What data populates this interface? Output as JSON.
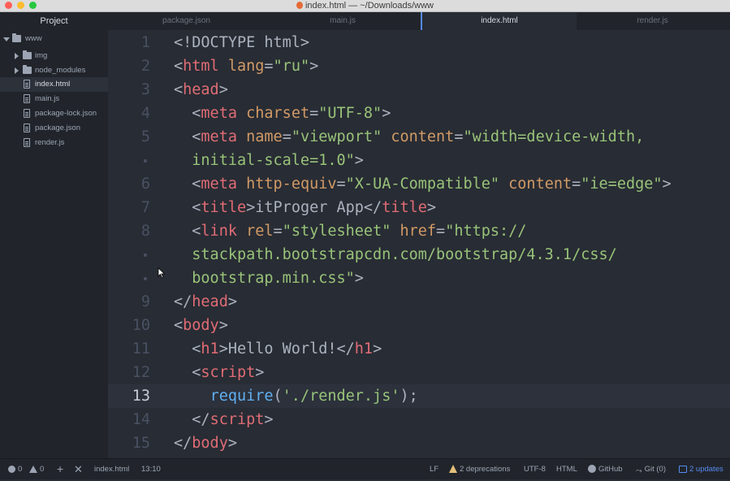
{
  "window": {
    "title": "index.html — ~/Downloads/www"
  },
  "tabs": {
    "project_label": "Project",
    "items": [
      {
        "label": "package.json"
      },
      {
        "label": "main.js"
      },
      {
        "label": "index.html"
      },
      {
        "label": "render.js"
      }
    ]
  },
  "tree": {
    "root": "www",
    "items": [
      {
        "label": "img",
        "type": "folder"
      },
      {
        "label": "node_modules",
        "type": "folder"
      },
      {
        "label": "index.html",
        "type": "file"
      },
      {
        "label": "main.js",
        "type": "file"
      },
      {
        "label": "package-lock.json",
        "type": "file"
      },
      {
        "label": "package.json",
        "type": "file"
      },
      {
        "label": "render.js",
        "type": "file"
      }
    ]
  },
  "editor": {
    "gutter": [
      "1",
      "2",
      "3",
      "4",
      "5",
      "",
      "6",
      "7",
      "8",
      "",
      "",
      "9",
      "10",
      "11",
      "12",
      "13",
      "14",
      "15"
    ],
    "current_line": "13"
  },
  "status": {
    "errors": "0",
    "warnings": "0",
    "file": "index.html",
    "position": "13:10",
    "line_ending": "LF",
    "deprecations": "2 deprecations",
    "encoding": "UTF-8",
    "grammar": "HTML",
    "github": "GitHub",
    "git": "Git (0)",
    "updates": "2 updates"
  },
  "colors": {
    "accent": "#568af2",
    "tag": "#e06c75",
    "attribute": "#d19a66",
    "string": "#98c379",
    "function": "#61afef",
    "warning": "#e5c07b"
  },
  "icons": [
    "folder-icon",
    "file-icon",
    "chevron-down-icon",
    "chevron-right-icon",
    "error-icon",
    "warning-icon",
    "plus-icon",
    "close-icon",
    "github-icon",
    "git-icon",
    "update-icon",
    "mouse-pointer-icon"
  ]
}
